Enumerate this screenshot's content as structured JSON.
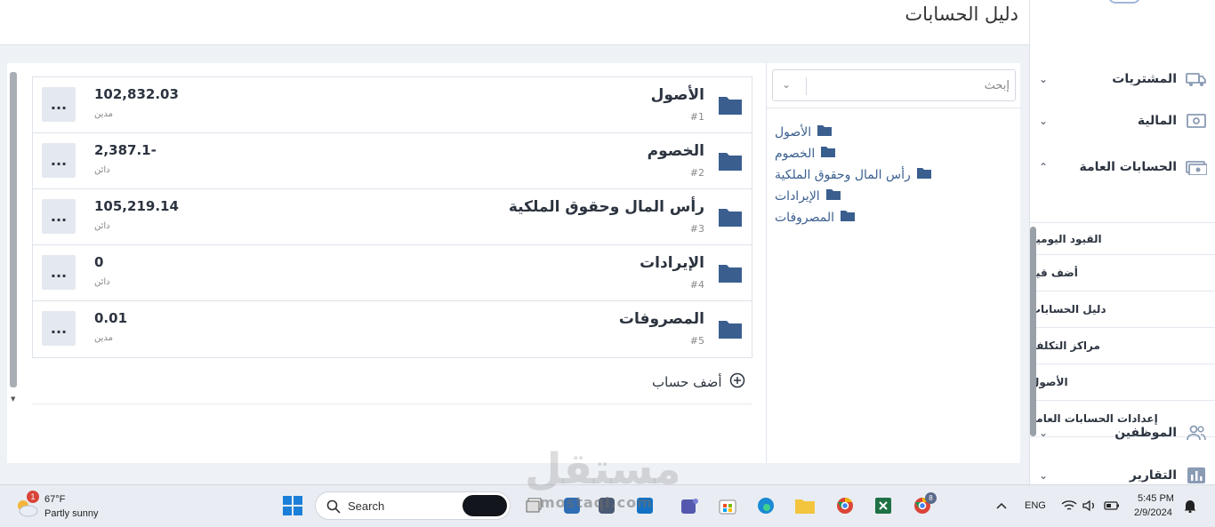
{
  "header": {
    "title": "دليل الحسابات"
  },
  "sidebar": {
    "items": [
      {
        "label": "المشتريات",
        "icon": "truck-icon",
        "expanded": false
      },
      {
        "label": "المالية",
        "icon": "money-icon",
        "expanded": false
      },
      {
        "label": "الحسابات العامة",
        "icon": "cash-icon",
        "expanded": true
      },
      {
        "label": "الموظفين",
        "icon": "users-icon",
        "expanded": false
      },
      {
        "label": "التقارير",
        "icon": "chart-icon",
        "expanded": false
      }
    ],
    "sub_items": [
      "القيود اليومية",
      "أضف قيد",
      "دليل الحسابات",
      "مراكز التكلفة",
      "الأصول",
      "إعدادات الحسابات العامه"
    ]
  },
  "tree": {
    "search_placeholder": "إبحث",
    "items": [
      "الأصول",
      "الخصوم",
      "رأس المال وحقوق الملكية",
      "الإيرادات",
      "المصروفات"
    ]
  },
  "accounts": [
    {
      "name": "الأصول",
      "number": "#1",
      "amount": "102,832.03",
      "type": "مدين"
    },
    {
      "name": "الخصوم",
      "number": "#2",
      "amount": "2,387.1-",
      "type": "دائن"
    },
    {
      "name": "رأس المال وحقوق الملكية",
      "number": "#3",
      "amount": "105,219.14",
      "type": "دائن"
    },
    {
      "name": "الإيرادات",
      "number": "#4",
      "amount": "0",
      "type": "دائن"
    },
    {
      "name": "المصروفات",
      "number": "#5",
      "amount": "0.01",
      "type": "مدين"
    }
  ],
  "menu_label": "...",
  "add_account_label": "أضف حساب",
  "taskbar": {
    "weather_temp": "67°F",
    "weather_cond": "Partly sunny",
    "weather_badge": "1",
    "search_label": "Search",
    "lang": "ENG",
    "time": "5:45 PM",
    "date": "2/9/2024",
    "chrome_badge": "8"
  },
  "watermark": {
    "text": "مستقل",
    "sub": "mostaql.com"
  },
  "colors": {
    "folder": "#3a5f8f",
    "accent": "#3a5f8f",
    "menu_bg": "#e4e9f0"
  }
}
